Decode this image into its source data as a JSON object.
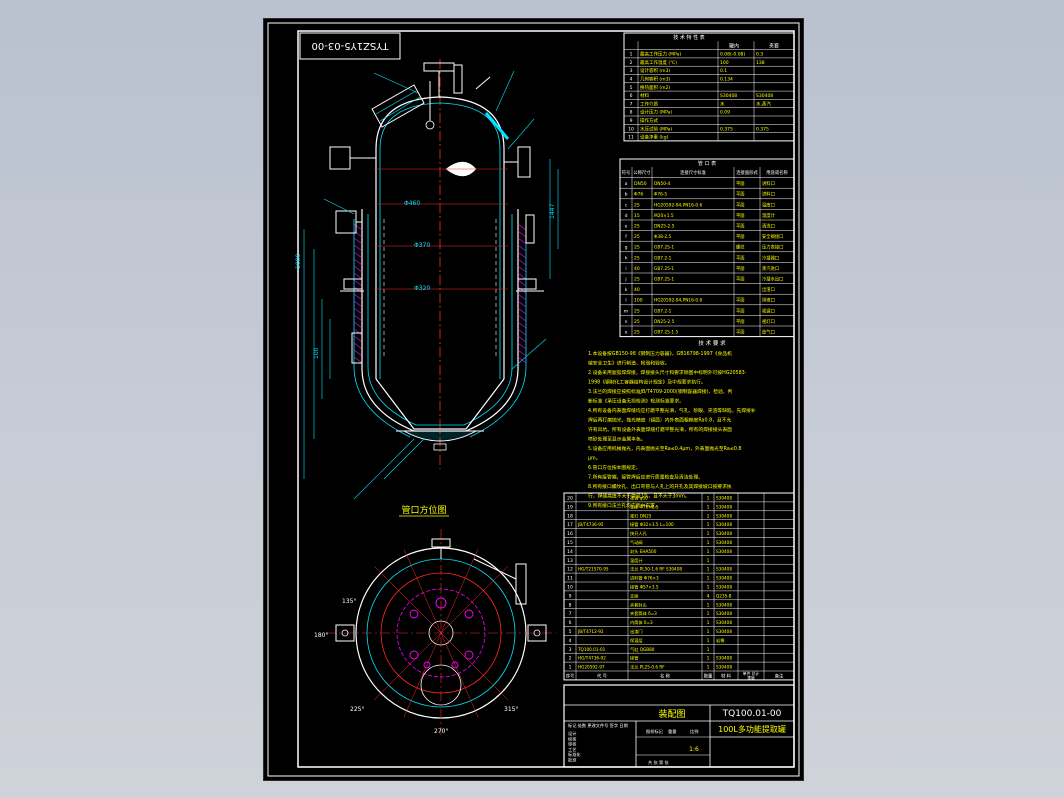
{
  "drawing": {
    "doc_number_rotated": "TYSZ1Y5-03-00",
    "view_title": "管口方位图",
    "drawing_no": "TQ100.01-00",
    "drawing_kind": "装配图",
    "drawing_name": "100L多功能提取罐"
  },
  "technical_table": {
    "title": "技 术 特 性 表",
    "col_headers": [
      "罐内",
      "夹套"
    ],
    "rows": [
      {
        "no": "1",
        "label": "最高工作压力 (MPa)",
        "v1": "0.08(-0.08)",
        "v2": "0.3"
      },
      {
        "no": "2",
        "label": "最高工作温度 (℃)",
        "v1": "100",
        "v2": "138"
      },
      {
        "no": "3",
        "label": "设计容积 (m3)",
        "v1": "0.1",
        "v2": ""
      },
      {
        "no": "4",
        "label": "几何容积 (m3)",
        "v1": "0.134",
        "v2": ""
      },
      {
        "no": "5",
        "label": "换热面积 (m2)",
        "v1": "",
        "v2": ""
      },
      {
        "no": "6",
        "label": "材料",
        "v1": "S30408",
        "v2": "S30408"
      },
      {
        "no": "7",
        "label": "工作介质",
        "v1": "水",
        "v2": "水,蒸汽"
      },
      {
        "no": "8",
        "label": "设计压力 (MPa)",
        "v1": "0.09",
        "v2": ""
      },
      {
        "no": "9",
        "label": "操作方式",
        "v1": "",
        "v2": ""
      },
      {
        "no": "10",
        "label": "水压试验 (MPa)",
        "v1": "0.375",
        "v2": "0.375"
      },
      {
        "no": "11",
        "label": "设备净重 (kg)",
        "v1": "",
        "v2": ""
      }
    ]
  },
  "nozzle_table": {
    "title": "管 口 表",
    "headers": [
      "符号",
      "公称尺寸",
      "连接尺寸标准",
      "连接面形式",
      "用途或名称"
    ],
    "rows": [
      {
        "sym": "a",
        "size": "DN50",
        "std": "DN50-4",
        "face": "平面",
        "use": "进料口"
      },
      {
        "sym": "b",
        "size": "Φ76",
        "std": "Φ76-5",
        "face": "平面",
        "use": "进料口"
      },
      {
        "sym": "c",
        "size": "25",
        "std": "HG20592-94,PN16-0.6",
        "face": "平面",
        "use": "温度口"
      },
      {
        "sym": "d",
        "size": "15",
        "std": "M20×1.5",
        "face": "平面",
        "use": "温度计"
      },
      {
        "sym": "e",
        "size": "25",
        "std": "DN25-2.5",
        "face": "平面",
        "use": "清洗口"
      },
      {
        "sym": "f",
        "size": "25",
        "std": "Φ38-2.5",
        "face": "平面",
        "use": "安全阀接口"
      },
      {
        "sym": "g",
        "size": "25",
        "std": "GB7.25-1",
        "face": "螺纹",
        "use": "压力表接口"
      },
      {
        "sym": "h",
        "size": "25",
        "std": "GB7.2-1",
        "face": "平面",
        "use": "冷凝器口"
      },
      {
        "sym": "i",
        "size": "40",
        "std": "GB7.25-1",
        "face": "平面",
        "use": "蒸汽进口"
      },
      {
        "sym": "j",
        "size": "25",
        "std": "GB7.25-1",
        "face": "平面",
        "use": "冷凝水出口"
      },
      {
        "sym": "k",
        "size": "40",
        "std": "",
        "face": "",
        "use": "出渣口"
      },
      {
        "sym": "l",
        "size": "100",
        "std": "HG20592-94,PN16-0.6",
        "face": "平面",
        "use": "排液口"
      },
      {
        "sym": "m",
        "size": "25",
        "std": "GB7.2-1",
        "face": "平面",
        "use": "视镜口"
      },
      {
        "sym": "n",
        "size": "25",
        "std": "DN25-2.5",
        "face": "平面",
        "use": "视灯口"
      },
      {
        "sym": "o",
        "size": "25",
        "std": "GB7.25-1.5",
        "face": "平面",
        "use": "放气口"
      }
    ]
  },
  "tech_requirements": {
    "title": "技 术 要 求",
    "lines": [
      "1.本设备按GB150-98《钢制压力容器》，GB16798-1997《食品机",
      "械安全卫生》进行制造、检验和验收。",
      "2.设备采用氩弧焊焊接，焊接接头尺寸和要求除图中标明外可按HG20583-",
      "1998《钢制化工容器结构设计规定》及中规要求执行。",
      "3.法兰的焊接应按照标准JB/T4709-2000(钢制容器焊接)、检验、判",
      "断标准《承压设备无损检测》检测标准要求。",
      "4.所有设备内表面焊缝均应打磨平整光滑，气孔、砂眼、夹渣等缺陷，先焊接补",
      "焊后再打磨抛光，抛光精度（镜面）内外表面粗糙度Ra0.8，且不允",
      "许有凹坑。所有设备外表面焊缝打磨平整光滑，所有的焊接接头表面",
      "喷砂处理至显示金属本色。",
      "5.设备应用机械抛光，内表面抛光至Ra≤0.4μm，外表面抛光至Ra≤0.8",
      "μm。",
      "6.管口方位按本图规定。",
      "7.所有接管端，接管焊后应进行质量检查及清洁处理。",
      "8.所有接口螺纹孔、出口弯管与人孔上的开孔及其焊接坡口按要求执",
      "行，焊缝高度不大于管径1%，且不大于3mm。",
      "9.所有接口法兰孔均应跨中布置。"
    ]
  },
  "bom": {
    "rows": [
      {
        "no": "20",
        "code": "",
        "name": "视镜 φ50",
        "qty": "1",
        "mat": "S30408",
        "note": ""
      },
      {
        "no": "19",
        "code": "",
        "name": "支座 Φ76×2.5",
        "qty": "1",
        "mat": "S30408",
        "note": ""
      },
      {
        "no": "18",
        "code": "",
        "name": "视灯 DN25",
        "qty": "1",
        "mat": "S30408",
        "note": ""
      },
      {
        "no": "17",
        "code": "JB/T4736-95",
        "name": "接管 Φ32×3.5 L=100",
        "qty": "1",
        "mat": "S30408",
        "note": ""
      },
      {
        "no": "16",
        "code": "",
        "name": "快开人孔",
        "qty": "1",
        "mat": "S30408",
        "note": ""
      },
      {
        "no": "15",
        "code": "",
        "name": "气动阀",
        "qty": "1",
        "mat": "S30408",
        "note": ""
      },
      {
        "no": "14",
        "code": "",
        "name": "封头 EHA500",
        "qty": "1",
        "mat": "S30408",
        "note": ""
      },
      {
        "no": "13",
        "code": "",
        "name": "温度计",
        "qty": "1",
        "mat": "",
        "note": ""
      },
      {
        "no": "12",
        "code": "HG/T21570-95",
        "name": "法兰 PL50-1.6 RF S30408",
        "qty": "1",
        "mat": "S30408",
        "note": ""
      },
      {
        "no": "11",
        "code": "",
        "name": "进料管 Φ76×3",
        "qty": "1",
        "mat": "S30408",
        "note": ""
      },
      {
        "no": "10",
        "code": "",
        "name": "接管 Φ57×3.5",
        "qty": "1",
        "mat": "S30408",
        "note": ""
      },
      {
        "no": "9",
        "code": "",
        "name": "支座",
        "qty": "4",
        "mat": "Q235-B",
        "note": ""
      },
      {
        "no": "8",
        "code": "",
        "name": "夹套封头",
        "qty": "1",
        "mat": "S30408",
        "note": ""
      },
      {
        "no": "7",
        "code": "",
        "name": "夹套筒体 δ=3",
        "qty": "1",
        "mat": "S30408",
        "note": ""
      },
      {
        "no": "6",
        "code": "",
        "name": "内筒体 δ=3",
        "qty": "1",
        "mat": "S30408",
        "note": ""
      },
      {
        "no": "5",
        "code": "JB/T4712-92",
        "name": "出渣门",
        "qty": "1",
        "mat": "S30408",
        "note": ""
      },
      {
        "no": "4",
        "code": "",
        "name": "保温层",
        "qty": "1",
        "mat": "岩棉",
        "note": ""
      },
      {
        "no": "3",
        "code": "TQ100.01-01",
        "name": "气缸 QGB80",
        "qty": "1",
        "mat": "",
        "note": ""
      },
      {
        "no": "2",
        "code": "HG/T4736-92",
        "name": "接管",
        "qty": "1",
        "mat": "S30408",
        "note": ""
      },
      {
        "no": "1",
        "code": "HG20592-97",
        "name": "法兰 PL25-0.6 RF",
        "qty": "1",
        "mat": "S30408",
        "note": ""
      }
    ],
    "header": {
      "no": "序号",
      "code": "代 号",
      "name": "名 称",
      "qty": "数量",
      "mat": "材 料",
      "unit_w": "单件",
      "total_w": "总计",
      "weight": "重量",
      "note": "备注"
    }
  },
  "title_block": {
    "labels": [
      "标记",
      "处数",
      "更改文件号",
      "签字",
      "日期",
      "设计",
      "校核",
      "审核",
      "工艺",
      "标准化",
      "批准"
    ],
    "stage_labels": [
      "图样标记",
      "重量",
      "比例"
    ],
    "scale": "1:6",
    "sheet": [
      "共",
      "张",
      "第",
      "张"
    ]
  },
  "annotations": {
    "angles": [
      "0°",
      "90°",
      "180°",
      "270°",
      "225°",
      "315°",
      "45°",
      "135°"
    ],
    "dims": [
      "Φ460",
      "Φ370",
      "Φ320",
      "2000",
      "1447",
      "100",
      "200",
      "500",
      "840",
      "1000",
      "1540",
      "2400"
    ]
  },
  "colors": {
    "sheet_bg": "#000000",
    "frame": "#ffffff",
    "cyan": "#00e5ff",
    "red": "#ff2a2a",
    "magenta": "#ff00ff",
    "yellow": "#ffff00",
    "green": "#00ff66"
  }
}
